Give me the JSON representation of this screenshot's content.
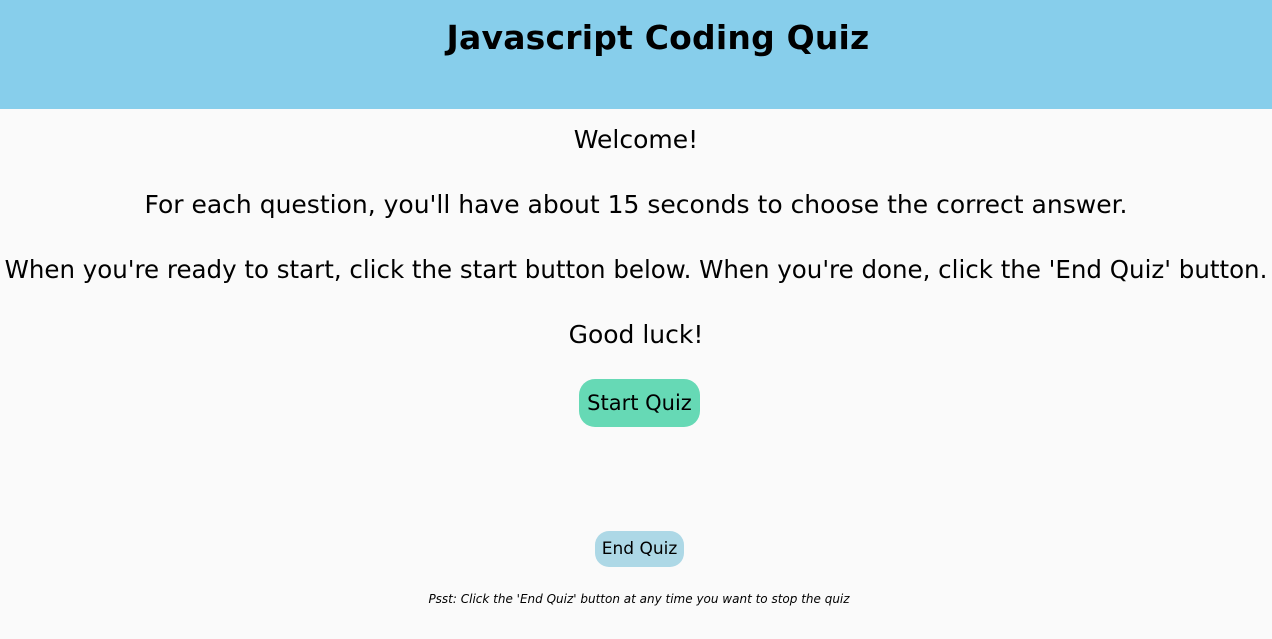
{
  "header": {
    "title": "Javascript Coding Quiz",
    "background_color": "#87ceeb"
  },
  "intro": {
    "welcome": "Welcome!",
    "instructions": "For each question, you'll have about 15 seconds to choose the correct answer.",
    "start_instructions": "When you're ready to start, click the start button below. When you're done, click the 'End Quiz' button.",
    "good_luck": "Good luck!"
  },
  "buttons": {
    "start_label": "Start Quiz",
    "start_color": "#66d9b5",
    "end_label": "End Quiz",
    "end_color": "#add8e6"
  },
  "footer": {
    "hint": "Psst: Click the 'End Quiz' button at any time you want to stop the quiz"
  }
}
